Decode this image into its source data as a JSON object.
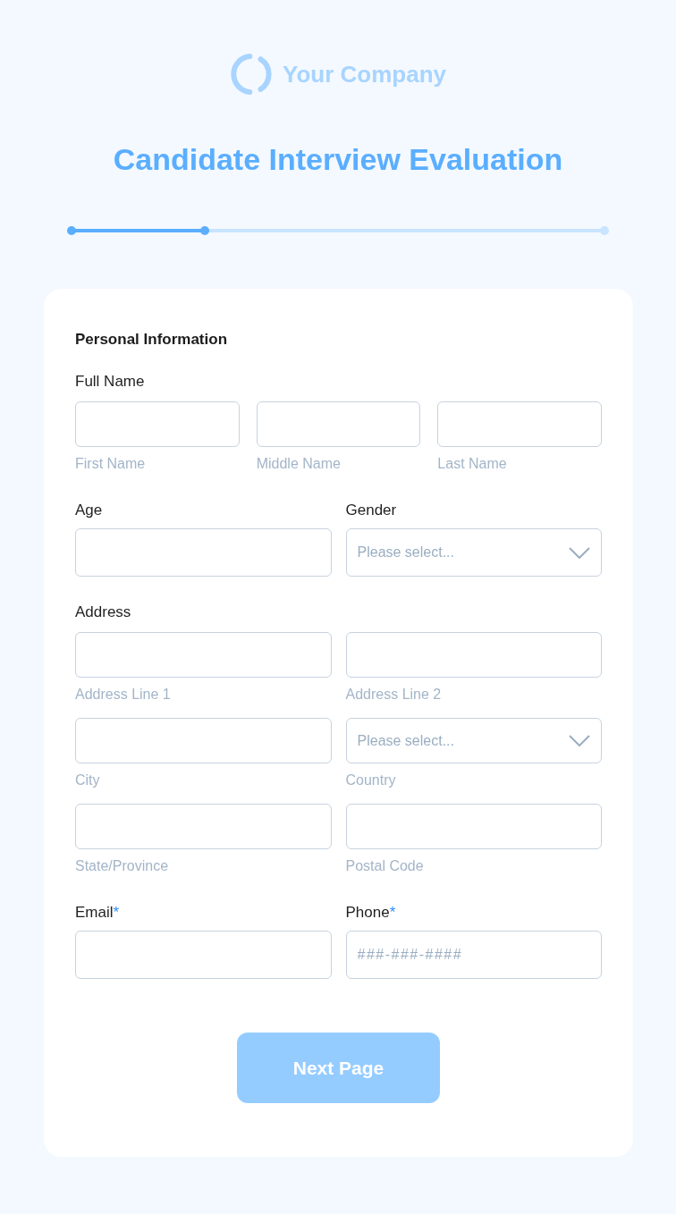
{
  "header": {
    "company": "Your Company",
    "title": "Candidate Interview Evaluation"
  },
  "progress": {
    "level": 0.25
  },
  "form": {
    "section_title": "Personal Information",
    "groups": [
      {
        "label": "Full Name",
        "rows": [
          [
            {
              "kind": "text",
              "caption": "First Name"
            },
            {
              "kind": "text",
              "caption": "Middle Name"
            },
            {
              "kind": "text",
              "caption": "Last Name"
            }
          ]
        ]
      },
      {
        "rows": [
          [
            {
              "kind": "text",
              "label": "Age"
            },
            {
              "kind": "select",
              "label": "Gender",
              "placeholder": "Please select..."
            }
          ]
        ]
      },
      {
        "label": "Address",
        "rows": [
          [
            {
              "kind": "text",
              "caption": "Address Line 1"
            },
            {
              "kind": "text",
              "caption": "Address Line 2"
            }
          ],
          [
            {
              "kind": "text",
              "caption": "City"
            },
            {
              "kind": "select",
              "placeholder": "Please select...",
              "caption": "Country"
            }
          ],
          [
            {
              "kind": "text",
              "caption": "State/Province"
            },
            {
              "kind": "text",
              "caption": "Postal Code"
            }
          ]
        ]
      },
      {
        "rows": [
          [
            {
              "kind": "text",
              "label": "Email",
              "mark": "*"
            },
            {
              "kind": "text",
              "label": "Phone",
              "mark": "*",
              "placeholder": "###-###-####"
            }
          ]
        ]
      }
    ]
  },
  "button": {
    "label": "Next Page"
  }
}
